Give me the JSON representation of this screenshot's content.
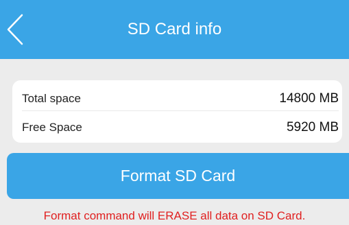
{
  "header": {
    "title": "SD Card info",
    "back_icon": "chevron-left-icon"
  },
  "storage": {
    "total_label": "Total space",
    "total_value": "14800 MB",
    "free_label": "Free Space",
    "free_value": "5920 MB"
  },
  "actions": {
    "format_label": "Format SD Card"
  },
  "warning": {
    "text": "Format command will ERASE all data on SD Card."
  },
  "colors": {
    "accent": "#3aa5e6",
    "background": "#ececec",
    "warning": "#e01f1f"
  }
}
